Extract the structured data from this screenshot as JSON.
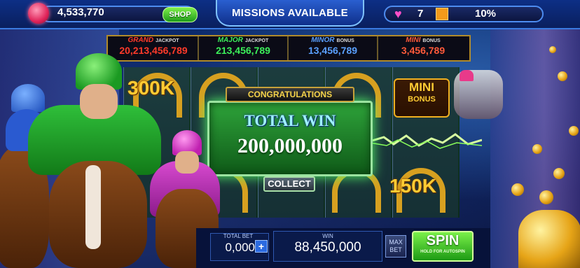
{
  "topbar": {
    "coins": "4,533,770",
    "shop_label": "SHOP",
    "missions_label": "MISSIONS AVAILABLE",
    "level": "7",
    "xp_percent": "10%"
  },
  "jackpots": [
    {
      "title": "GRAND",
      "suffix": "JACKPOT",
      "value": "20,213,456,789",
      "color": "#ff3a2a"
    },
    {
      "title": "MAJOR",
      "suffix": "JACKPOT",
      "value": "213,456,789",
      "color": "#3cf05a"
    },
    {
      "title": "MINOR",
      "suffix": "BONUS",
      "value": "13,456,789",
      "color": "#5aa0ff"
    },
    {
      "title": "MINI",
      "suffix": "BONUS",
      "value": "3,456,789",
      "color": "#ff5a3a"
    }
  ],
  "reels": {
    "symbol_300k": "300K",
    "symbol_150k": "150K",
    "mini_bonus_line1": "MINI",
    "mini_bonus_line2": "BONUS"
  },
  "popup": {
    "congrats": "CONGRATULATIONS",
    "total_win_label": "TOTAL WIN",
    "total_win_amount": "200,000,000",
    "collect_label": "COLLECT"
  },
  "bottombar": {
    "bet_label": "TOTAL BET",
    "bet_value": "0,000",
    "bet_plus": "+",
    "win_label": "WIN",
    "win_value": "88,450,000",
    "max_bet_label": "MAX BET",
    "spin_label": "SPIN",
    "spin_sub": "HOLD FOR AUTOSPIN"
  },
  "icons": {
    "coin": "gem-coin-icon",
    "heart": "heart-icon",
    "xp": "xp-bar-icon"
  }
}
